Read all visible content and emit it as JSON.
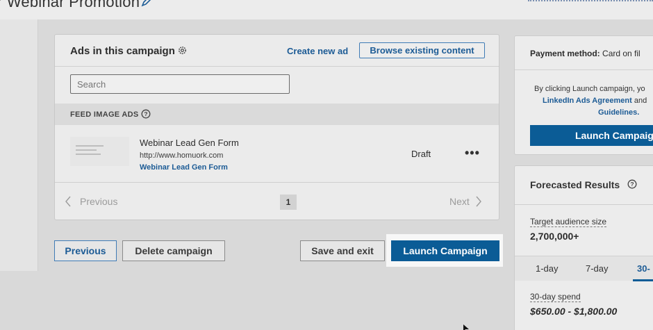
{
  "header": {
    "title": "r Webinar Promotion"
  },
  "ads_card": {
    "title": "Ads in this campaign",
    "create_link": "Create new ad",
    "browse_button": "Browse existing content",
    "search_placeholder": "Search",
    "section_label": "FEED IMAGE ADS",
    "ad": {
      "name": "Webinar Lead Gen Form",
      "url": "http://www.homuork.com",
      "form_link": "Webinar Lead Gen Form",
      "status": "Draft",
      "more": "•••"
    },
    "pagination": {
      "previous": "Previous",
      "page": "1",
      "next": "Next"
    }
  },
  "actions": {
    "previous": "Previous",
    "delete": "Delete campaign",
    "save_exit": "Save and exit",
    "launch": "Launch Campaign"
  },
  "payment": {
    "method_label": "Payment method:",
    "method_value": "Card on fil",
    "terms_line1": "By clicking Launch campaign, yo",
    "terms_link": "LinkedIn Ads Agreement",
    "terms_and": "and",
    "terms_line3": "Guidelines.",
    "launch_button": "Launch Campaig"
  },
  "forecast": {
    "title": "Forecasted Results",
    "audience_label": "Target audience size",
    "audience_value": "2,700,000+",
    "tabs": [
      "1-day",
      "7-day",
      "30-"
    ],
    "spend_label": "30-day spend",
    "spend_value": "$650.00 - $1,800.00"
  },
  "colors": {
    "accent": "#0b5c96",
    "link": "#1c5b95",
    "background": "#d9d9d9"
  }
}
